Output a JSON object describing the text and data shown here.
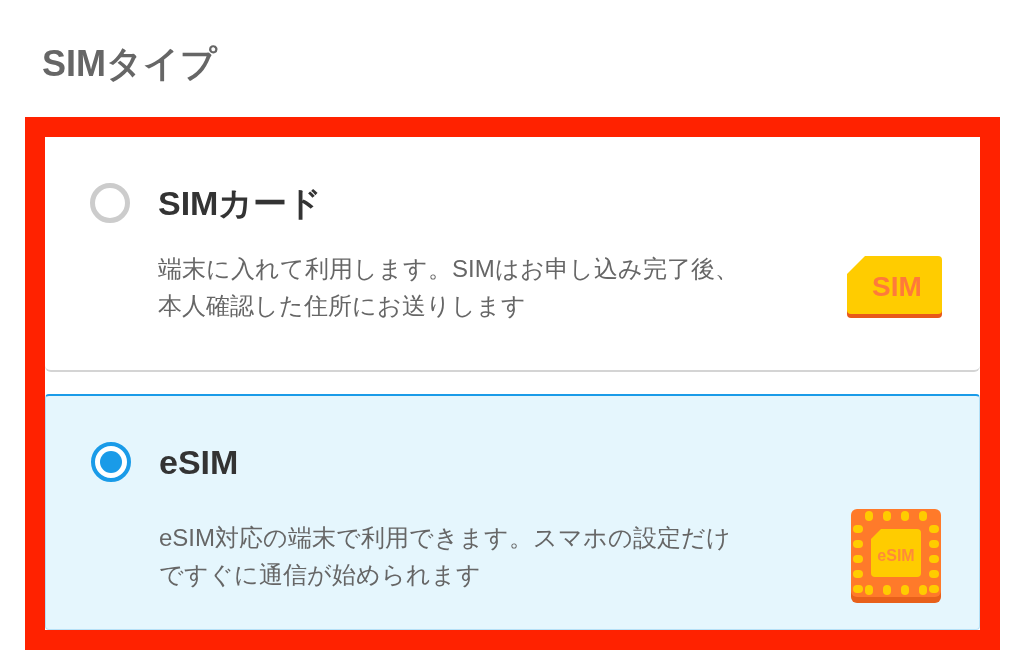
{
  "heading": "SIMタイプ",
  "options": [
    {
      "kind": "sim_card",
      "title": "SIMカード",
      "description_lines": [
        "端末に入れて利用します。SIMはお申し込み完了後、",
        "本人確認した住所にお送りします"
      ],
      "icon_label": "SIM",
      "selected": false
    },
    {
      "kind": "esim",
      "title": "eSIM",
      "description_lines": [
        "eSIM対応の端末で利用できます。スマホの設定だけ",
        "ですぐに通信が始められます"
      ],
      "icon_label": "eSIM",
      "selected": true
    }
  ]
}
